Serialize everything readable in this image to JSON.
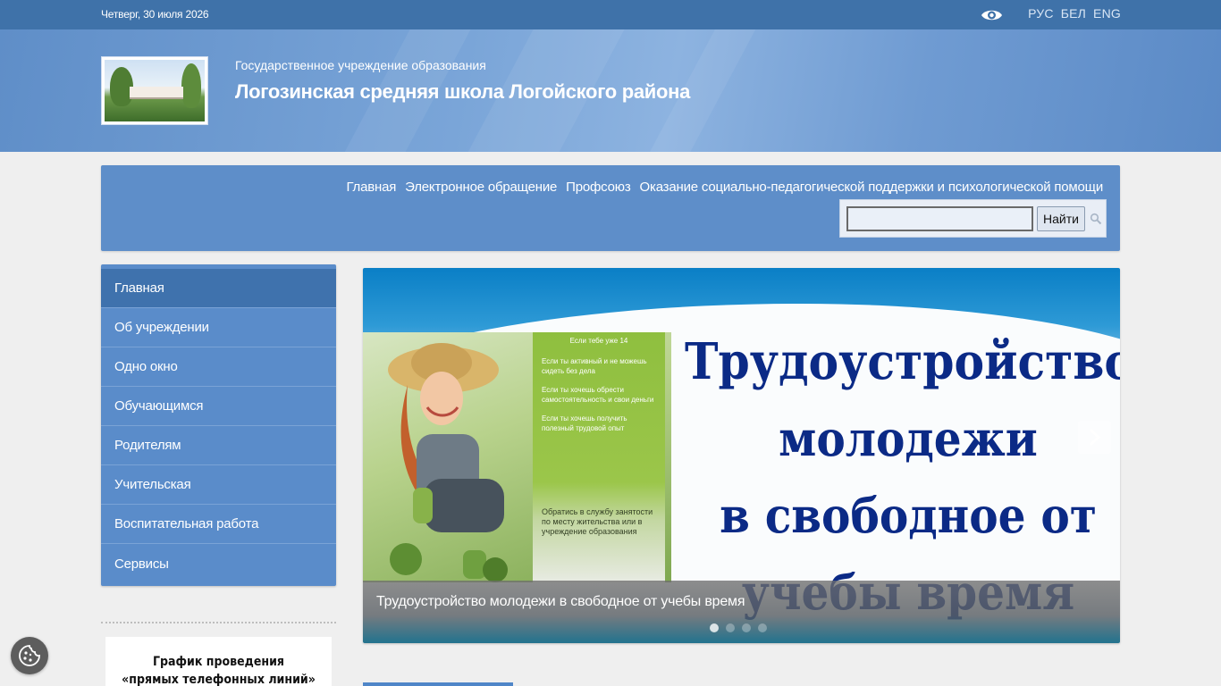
{
  "topbar": {
    "date": "Четверг, 30 июля 2026",
    "languages": [
      "РУС",
      "БЕЛ",
      "ENG"
    ]
  },
  "header": {
    "subtitle": "Государственное учреждение образования",
    "title": "Логозинская средняя школа Логойского района"
  },
  "nav": {
    "links": [
      "Главная",
      "Электронное обращение",
      "Профсоюз",
      "Оказание социально-педагогической поддержки и психологической помощи"
    ],
    "search": {
      "value": "",
      "button_label": "Найти"
    }
  },
  "sidebar": {
    "items": [
      {
        "label": "Главная",
        "active": true
      },
      {
        "label": "Об учреждении",
        "active": false
      },
      {
        "label": "Одно окно",
        "active": false
      },
      {
        "label": "Обучающимся",
        "active": false
      },
      {
        "label": "Родителям",
        "active": false
      },
      {
        "label": "Учительская",
        "active": false
      },
      {
        "label": "Воспитательная работа",
        "active": false
      },
      {
        "label": "Сервисы",
        "active": false
      }
    ]
  },
  "banner": {
    "line1": "График проведения",
    "line2": "«прямых телефонных линий»"
  },
  "slider": {
    "caption": "Трудоустройство молодежи в свободное от учебы время",
    "headline_lines": [
      "Трудоустройство",
      "молодежи",
      "в свободное от",
      "учебы время"
    ],
    "panel": {
      "head": "Если тебе уже 14",
      "p1": "Если ты активный и не можешь сидеть без дела",
      "p2": "Если ты хочешь обрести самостоятельность и свои деньги",
      "p3": "Если ты хочешь получить полезный трудовой опыт",
      "note": "Обратись в службу занятости по месту жительства или в учреждение образования"
    },
    "dots": 4,
    "active_dot": 0
  },
  "colors": {
    "topbar": "#3f72a9",
    "accent": "#5a8cca",
    "active": "#3f72ad",
    "headline": "#0b2a86"
  }
}
